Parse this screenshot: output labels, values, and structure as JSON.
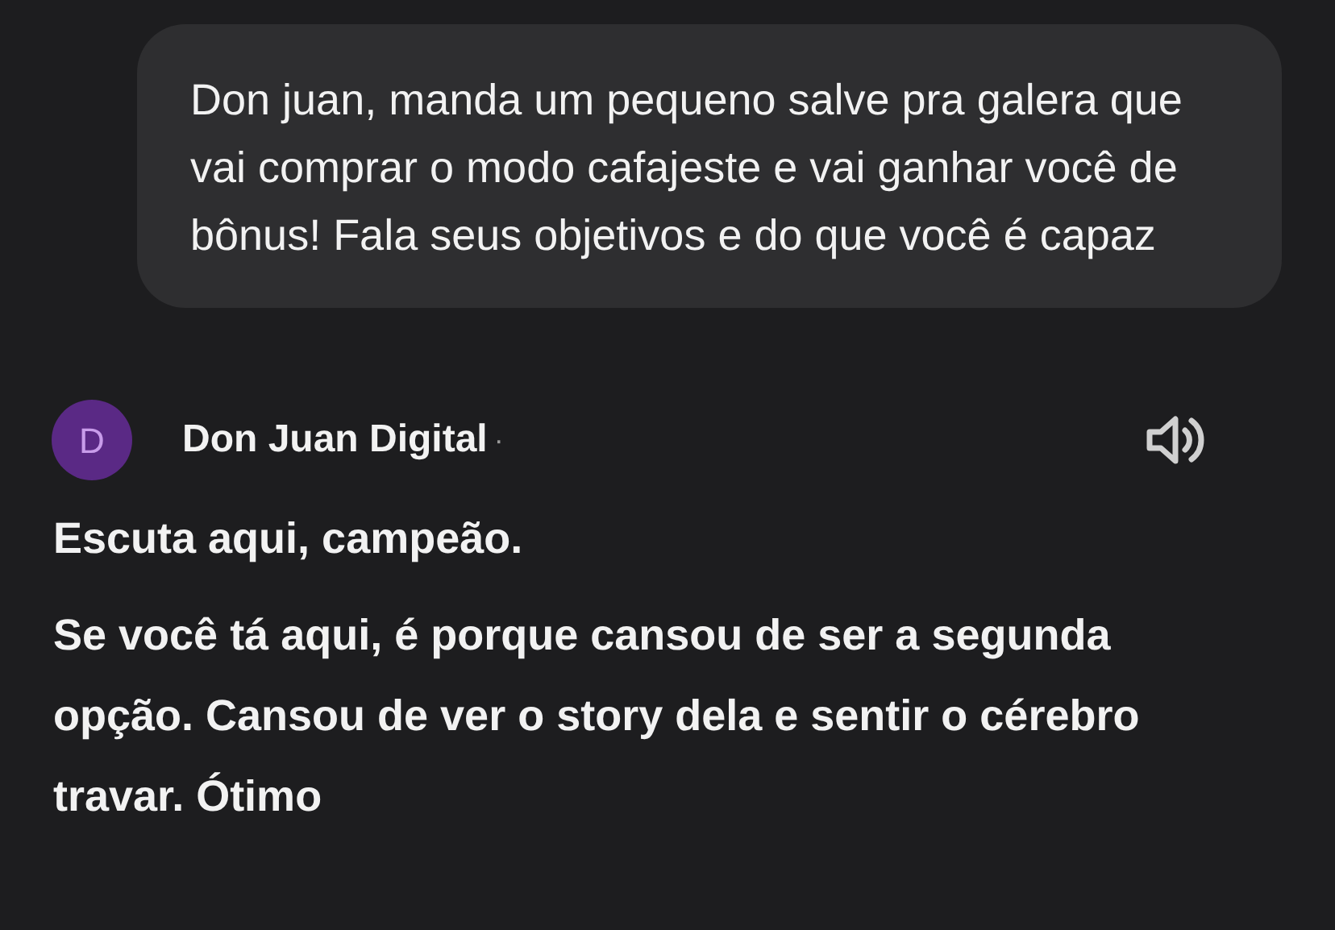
{
  "user_message": {
    "text": "Don juan, manda um pequeno salve pra galera que vai comprar o modo cafajeste e vai ganhar você de bônus! Fala seus objetivos e do que você é capaz"
  },
  "reply": {
    "avatar_letter": "D",
    "sender": "Don Juan Digital",
    "separator": "·",
    "paragraphs": [
      {
        "text": "Escuta aqui, campeão."
      },
      {
        "text": "Se você tá aqui, é porque cansou de ser a segunda opção. Cansou de ver o story dela e sentir o cérebro travar. Ótimo"
      }
    ]
  }
}
